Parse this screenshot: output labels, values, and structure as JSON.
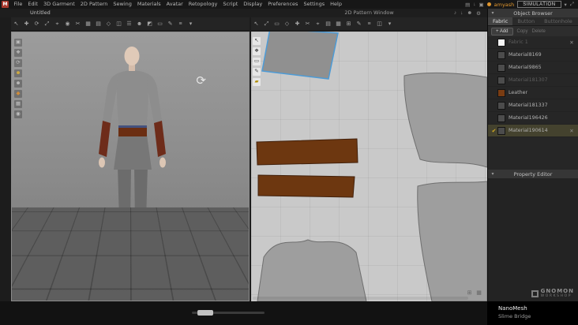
{
  "menu": {
    "logo": "M",
    "items": [
      "File",
      "Edit",
      "3D Garment",
      "2D Pattern",
      "Sewing",
      "Materials",
      "Avatar",
      "Retopology",
      "Script",
      "Display",
      "Preferences",
      "Settings",
      "Help"
    ],
    "right": {
      "icons": [
        {
          "glyph": "▤",
          "name": "library-icon"
        },
        {
          "glyph": "↓",
          "name": "download-icon"
        },
        {
          "glyph": "▣",
          "name": "display-icon"
        }
      ],
      "username": "amyash",
      "simulation": "SIMULATION",
      "after_icons": [
        {
          "glyph": "▾",
          "name": "dropdown-icon"
        },
        {
          "glyph": "⤢",
          "name": "fullscreen-icon"
        }
      ]
    }
  },
  "subbar": {
    "untitled_tab": "Untitled",
    "pattern_window_title": "2D Pattern Window",
    "icons": [
      {
        "glyph": "♪",
        "name": "sound-icon"
      },
      {
        "glyph": "↓",
        "name": "download-icon"
      },
      {
        "glyph": "☻",
        "name": "account-icon"
      },
      {
        "glyph": "⚙",
        "name": "settings-icon"
      }
    ]
  },
  "toolbar3d": {
    "icons": [
      {
        "glyph": "↖",
        "name": "select-icon"
      },
      {
        "glyph": "✚",
        "name": "move-icon"
      },
      {
        "glyph": "⟳",
        "name": "rotate-icon"
      },
      {
        "glyph": "⤢",
        "name": "scale-icon"
      },
      {
        "glyph": "⌖",
        "name": "gizmo-icon"
      },
      {
        "glyph": "◉",
        "name": "pin-icon"
      },
      {
        "glyph": "✂",
        "name": "scissors-icon"
      },
      {
        "glyph": "▦",
        "name": "mesh-icon"
      },
      {
        "glyph": "▤",
        "name": "layers-icon"
      },
      {
        "glyph": "◇",
        "name": "diamond-icon"
      },
      {
        "glyph": "◫",
        "name": "window-icon"
      },
      {
        "glyph": "☰",
        "name": "list-icon"
      },
      {
        "glyph": "☻",
        "name": "avatar-icon"
      },
      {
        "glyph": "◩",
        "name": "overlay-icon"
      },
      {
        "glyph": "▭",
        "name": "plane-icon"
      },
      {
        "glyph": "✎",
        "name": "pen-icon"
      },
      {
        "glyph": "≡",
        "name": "stack-icon"
      },
      {
        "glyph": "▾",
        "name": "more-icon"
      }
    ]
  },
  "toolbar2d": {
    "icons": [
      {
        "glyph": "↖",
        "name": "select-2d-icon"
      },
      {
        "glyph": "⤢",
        "name": "transform-2d-icon"
      },
      {
        "glyph": "▭",
        "name": "rect-2d-icon"
      },
      {
        "glyph": "◇",
        "name": "polygon-2d-icon"
      },
      {
        "glyph": "✚",
        "name": "add-point-2d-icon"
      },
      {
        "glyph": "✂",
        "name": "cut-2d-icon"
      },
      {
        "glyph": "⌖",
        "name": "target-2d-icon"
      },
      {
        "glyph": "▤",
        "name": "rows-2d-icon"
      },
      {
        "glyph": "▦",
        "name": "grid-2d-icon"
      },
      {
        "glyph": "⊞",
        "name": "texture-2d-icon"
      },
      {
        "glyph": "✎",
        "name": "edit-2d-icon"
      },
      {
        "glyph": "≡",
        "name": "list-2d-icon"
      },
      {
        "glyph": "◫",
        "name": "window-2d-icon"
      },
      {
        "glyph": "▾",
        "name": "more-2d-icon"
      }
    ]
  },
  "viewport3d": {
    "rotate_gizmo": "⟳",
    "side_icons": [
      {
        "glyph": "▣",
        "name": "snapshot-icon",
        "color": "#c0c0c0"
      },
      {
        "glyph": "❖",
        "name": "pan-icon",
        "color": "#c0c0c0"
      },
      {
        "glyph": "⟳",
        "name": "reset-view-icon",
        "color": "#c0c0c0"
      },
      {
        "glyph": "☻",
        "name": "show-avatar-icon",
        "color": "#d8b13c"
      },
      {
        "glyph": "☻",
        "name": "hide-avatar-icon",
        "color": "#c0c0c0"
      },
      {
        "glyph": "◆",
        "name": "show-garment-icon",
        "color": "#cf8c3a"
      },
      {
        "glyph": "▦",
        "name": "mesh-display-icon",
        "color": "#c0c0c0"
      },
      {
        "glyph": "◉",
        "name": "pins-display-icon",
        "color": "#c0c0c0"
      }
    ]
  },
  "pattern2d": {
    "side_icons": [
      {
        "glyph": "↖",
        "name": "select-pattern-icon",
        "color": "#444444"
      },
      {
        "glyph": "❖",
        "name": "pan-pattern-icon",
        "color": "#444444"
      },
      {
        "glyph": "▭",
        "name": "rect-pattern-icon",
        "color": "#444444"
      },
      {
        "glyph": "✎",
        "name": "edit-pattern-icon",
        "color": "#444444"
      },
      {
        "glyph": "▰",
        "name": "note-icon",
        "color": "#b08d00"
      }
    ],
    "corner_icons": [
      {
        "glyph": "⊞",
        "name": "grid-toggle-icon"
      },
      {
        "glyph": "▦",
        "name": "texture-toggle-icon"
      }
    ]
  },
  "object_browser": {
    "title": "Object Browser",
    "caret": "▾",
    "tabs": [
      {
        "label": "Fabric",
        "cls": "active"
      },
      {
        "label": "Button",
        "cls": "dim"
      },
      {
        "label": "Buttonhole",
        "cls": "dim"
      }
    ],
    "add_label": "+ Add",
    "aux_buttons": [
      "Copy",
      "Delete"
    ],
    "fabrics": [
      {
        "name": "Fabric 1",
        "color": "#f5f5f5",
        "cls": "dim",
        "check": "",
        "trash": "✕"
      },
      {
        "name": "Material8169",
        "color": "#4c4c4c",
        "cls": "",
        "check": "",
        "trash": ""
      },
      {
        "name": "Material9865",
        "color": "#4c4c4c",
        "cls": "",
        "check": "",
        "trash": ""
      },
      {
        "name": "Material181307",
        "color": "#4c4c4c",
        "cls": "dim",
        "check": "",
        "trash": ""
      },
      {
        "name": "Leather",
        "color": "#7a3c12",
        "cls": "",
        "check": "",
        "trash": ""
      },
      {
        "name": "Material181337",
        "color": "#4c4c4c",
        "cls": "",
        "check": "",
        "trash": ""
      },
      {
        "name": "Material196426",
        "color": "#4c4c4c",
        "cls": "",
        "check": "",
        "trash": ""
      },
      {
        "name": "Material190614",
        "color": "#4c4c4c",
        "cls": "selected",
        "check": "✔",
        "trash": "✕"
      }
    ]
  },
  "property_editor": {
    "title": "Property Editor",
    "caret": "▾"
  },
  "statusbar": {
    "line1": "NanoMesh",
    "line2": "Slime Bridge"
  },
  "watermark": {
    "line1": "GNOMON",
    "line2": "WORKSHOP"
  },
  "colors": {
    "accent_orange": "#e0962e",
    "leather_brown": "#6d3710",
    "pattern_blue_outline": "#4d9bd6",
    "selected_row": "#44422e"
  }
}
